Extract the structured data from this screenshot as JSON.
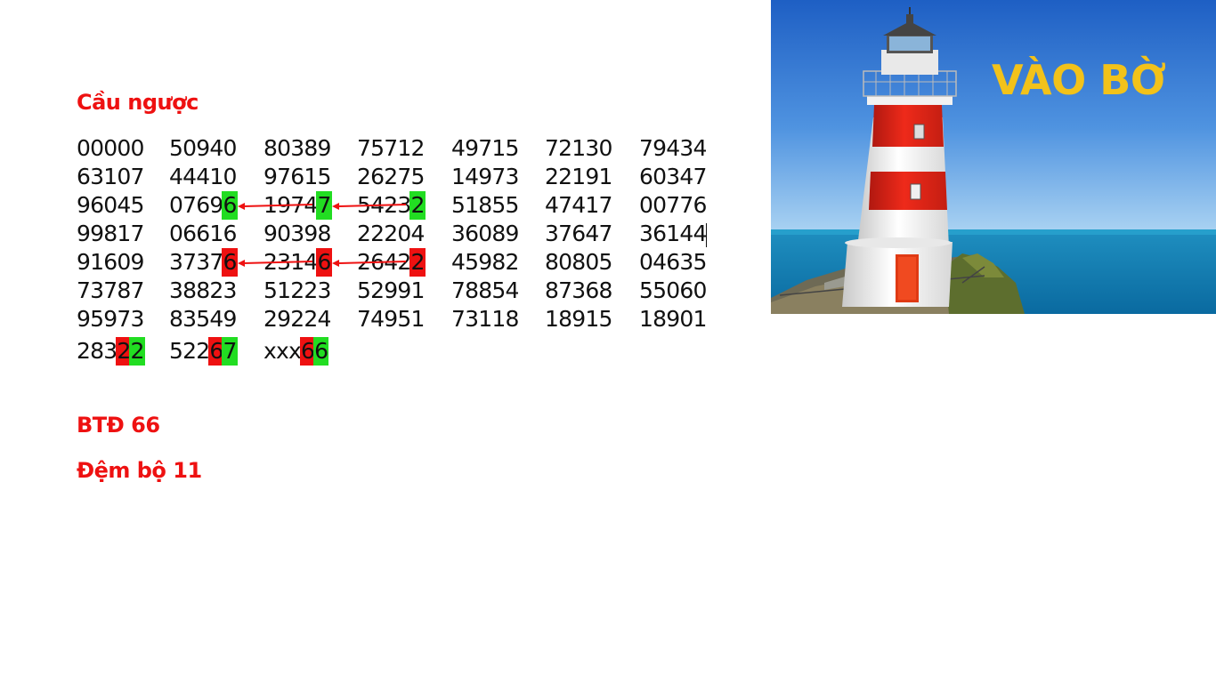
{
  "slide": {
    "title": "Cầu ngược",
    "image_caption": "VÀO BỜ",
    "image_subject": "lighthouse",
    "notes": [
      "BTĐ 66",
      "Đệm bộ 11"
    ],
    "colors": {
      "title_red": "#ee1111",
      "highlight_green": "#22dd22",
      "highlight_red": "#ee1111",
      "caption_yellow": "#f2c21a"
    },
    "rows": [
      [
        "00000",
        "50940",
        "80389",
        "75712",
        "49715",
        "72130",
        "79434"
      ],
      [
        "63107",
        "44410",
        "97615",
        "26275",
        "14973",
        "22191",
        "60347"
      ],
      [
        "96045",
        "07696",
        "19747",
        "54232",
        "51855",
        "47417",
        "00776"
      ],
      [
        "99817",
        "06616",
        "90398",
        "22204",
        "36089",
        "37647",
        "36144"
      ],
      [
        "91609",
        "37376",
        "23146",
        "26422",
        "45982",
        "80805",
        "04635"
      ],
      [
        "73787",
        "38823",
        "51223",
        "52991",
        "78854",
        "87368",
        "55060"
      ],
      [
        "95973",
        "83549",
        "29224",
        "74951",
        "73118",
        "18915",
        "18901"
      ],
      [
        "28322",
        "52267",
        "xxx66"
      ]
    ],
    "highlights": [
      {
        "row": 2,
        "col": 1,
        "char": 4,
        "color": "green"
      },
      {
        "row": 2,
        "col": 2,
        "char": 4,
        "color": "green"
      },
      {
        "row": 2,
        "col": 3,
        "char": 4,
        "color": "green"
      },
      {
        "row": 4,
        "col": 1,
        "char": 4,
        "color": "red"
      },
      {
        "row": 4,
        "col": 2,
        "char": 4,
        "color": "red"
      },
      {
        "row": 4,
        "col": 3,
        "char": 4,
        "color": "red"
      },
      {
        "row": 7,
        "col": 0,
        "char": 3,
        "color": "red"
      },
      {
        "row": 7,
        "col": 0,
        "char": 4,
        "color": "green"
      },
      {
        "row": 7,
        "col": 1,
        "char": 3,
        "color": "red"
      },
      {
        "row": 7,
        "col": 1,
        "char": 4,
        "color": "green"
      },
      {
        "row": 7,
        "col": 2,
        "char": 3,
        "color": "red"
      },
      {
        "row": 7,
        "col": 2,
        "char": 4,
        "color": "green"
      }
    ],
    "arrows": [
      {
        "row": 2,
        "from_col": 3,
        "to_col": 2
      },
      {
        "row": 2,
        "from_col": 2,
        "to_col": 1
      },
      {
        "row": 4,
        "from_col": 3,
        "to_col": 2
      },
      {
        "row": 4,
        "from_col": 2,
        "to_col": 1
      }
    ]
  }
}
